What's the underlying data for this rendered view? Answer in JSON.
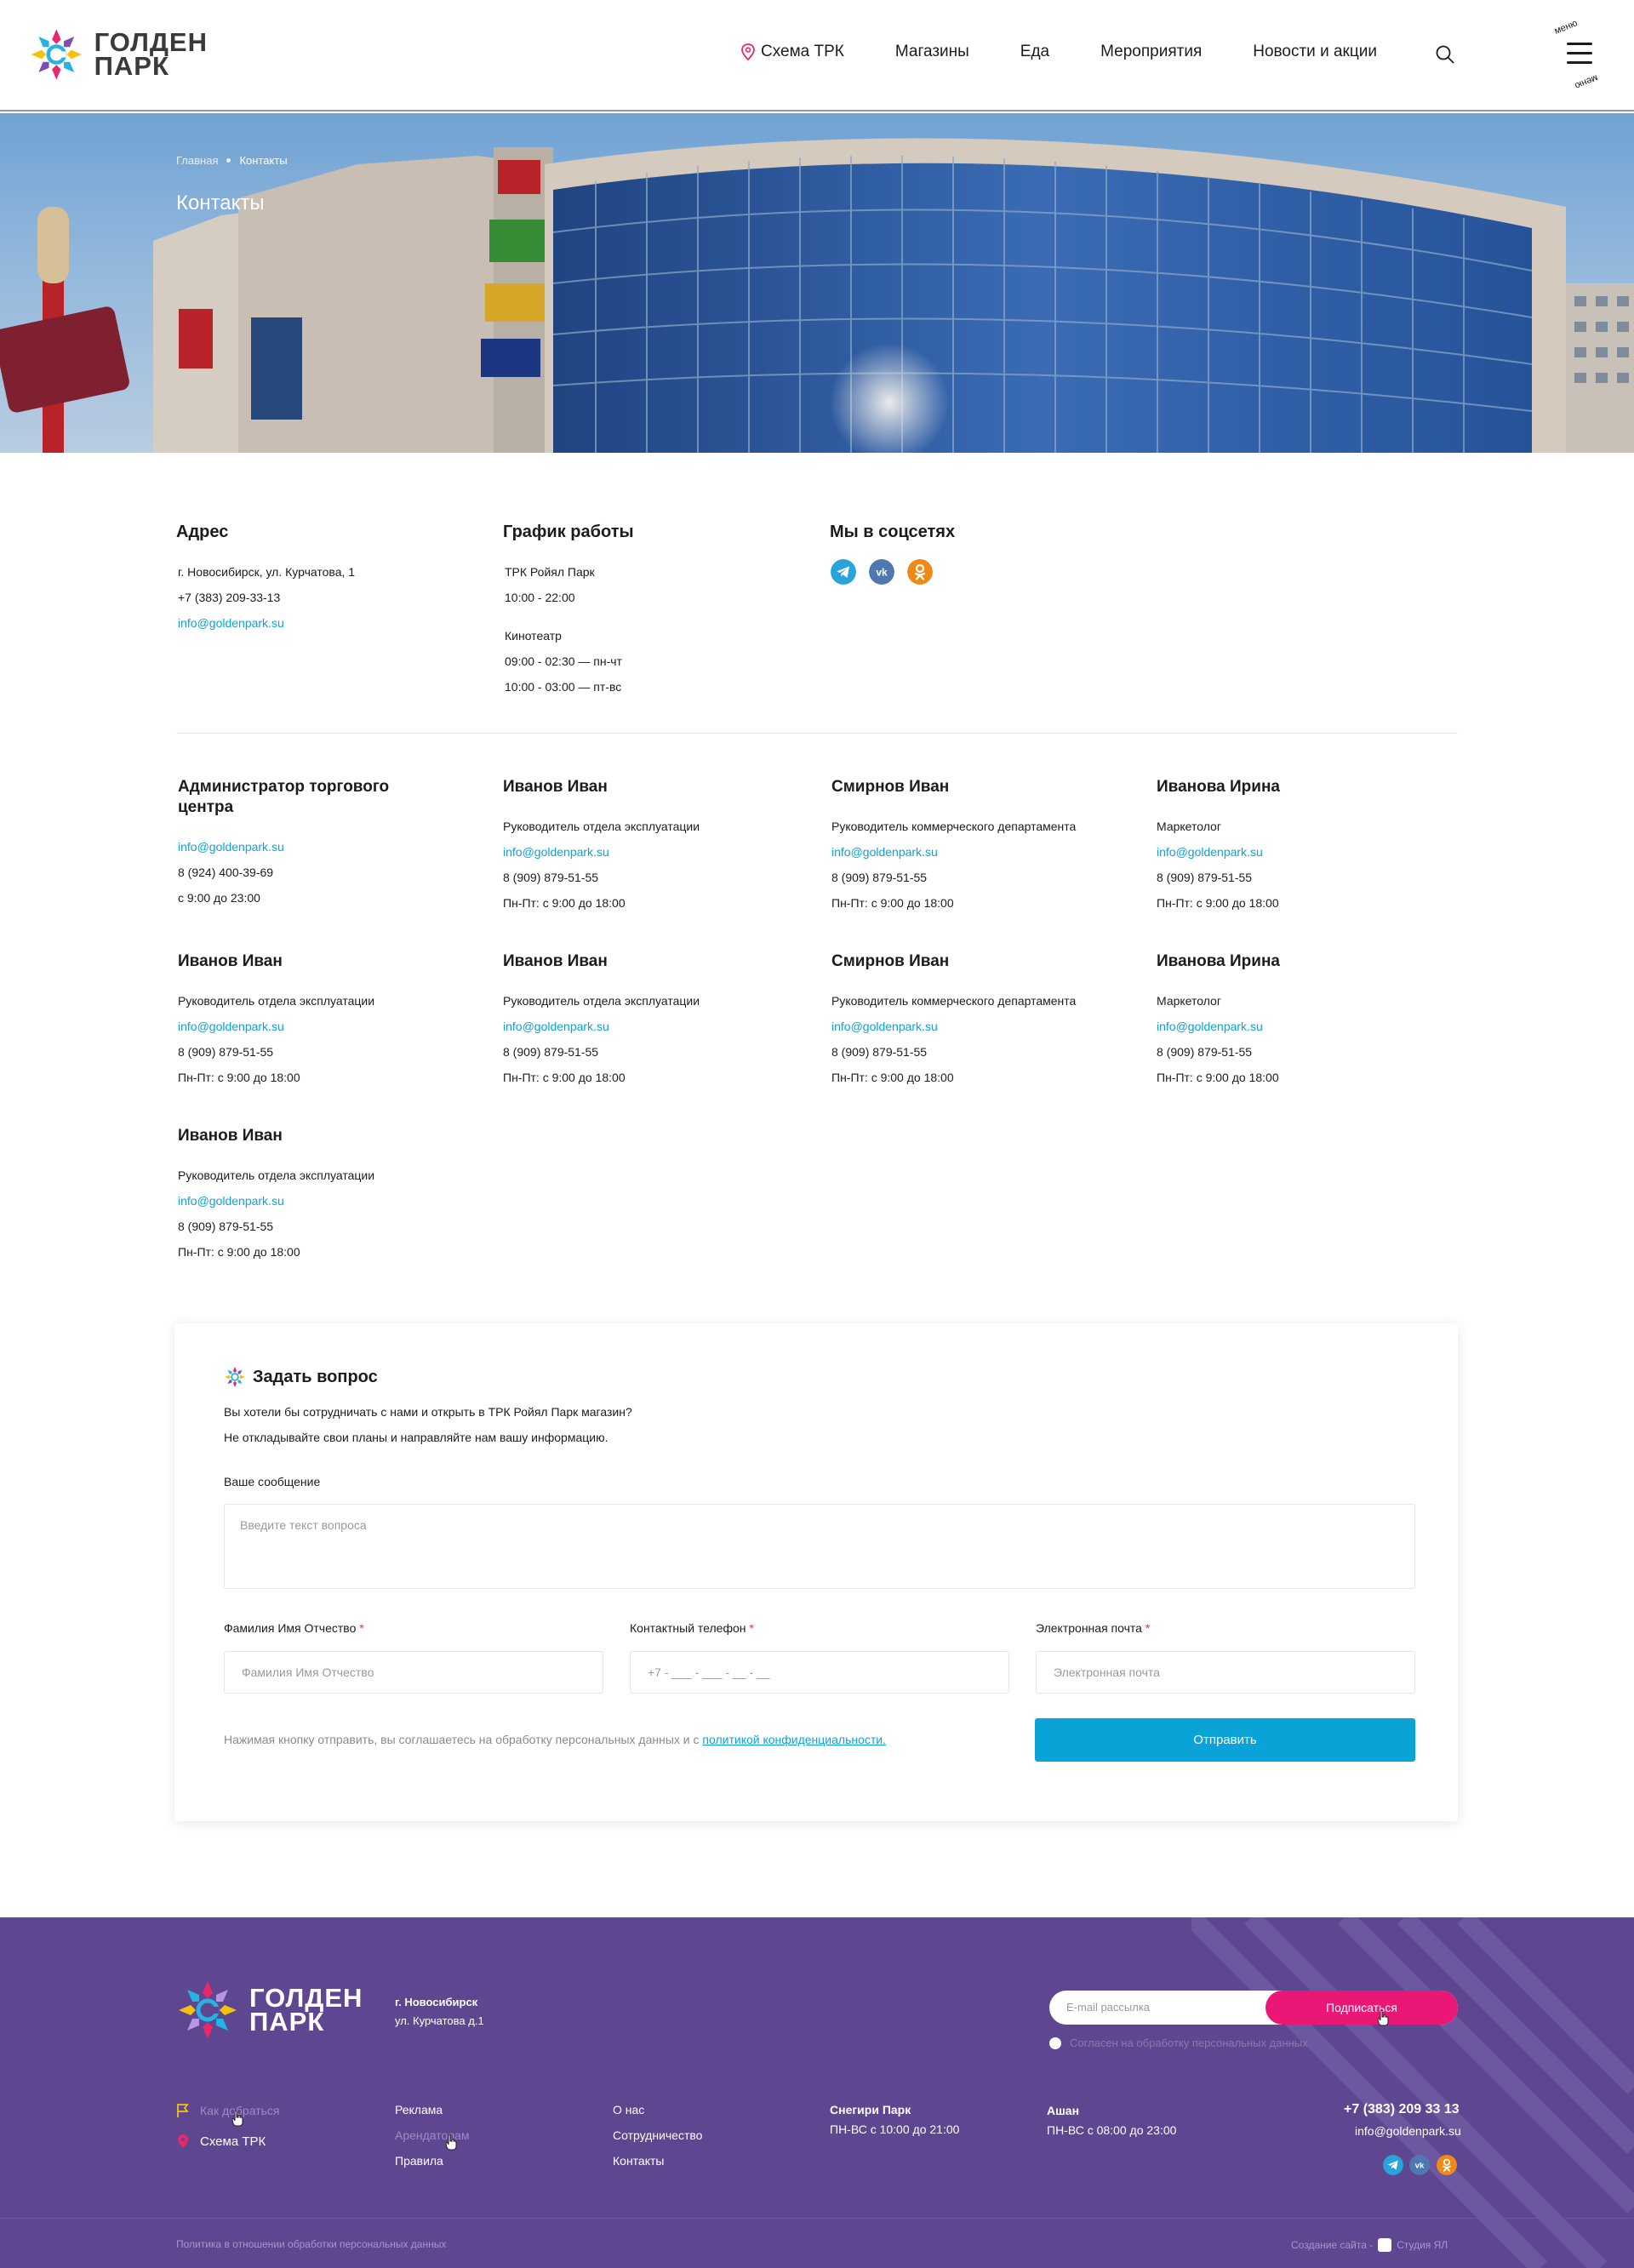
{
  "header": {
    "logo_line1": "ГОЛДЕН",
    "logo_line2": "ПАРК",
    "nav": {
      "scheme": "Схема ТРК",
      "shops": "Магазины",
      "food": "Еда",
      "events": "Мероприятия",
      "news": "Новости и акции"
    },
    "menu_label": "меню"
  },
  "hero": {
    "breadcrumb_home": "Главная",
    "breadcrumb_current": "Контакты",
    "title": "Контакты"
  },
  "info": {
    "address": {
      "title": "Адрес",
      "line": "г. Новосибирск, ул. Курчатова, 1",
      "phone": "+7 (383) 209-33-13",
      "email": "info@goldenpark.su"
    },
    "schedule": {
      "title": "График работы",
      "mall_name": "ТРК Ройял Парк",
      "mall_hours": "10:00 - 22:00",
      "cinema_name": "Кинотеатр",
      "cinema_hours_1": "09:00 - 02:30 — пн-чт",
      "cinema_hours_2": "10:00 - 03:00 — пт-вс"
    },
    "social": {
      "title": "Мы в соцсетях",
      "icons": [
        "telegram-icon",
        "vk-icon",
        "odnoklassniki-icon"
      ],
      "colors": {
        "telegram": "#2aa3db",
        "vk": "#4f78b3",
        "ok": "#f08a16"
      }
    }
  },
  "staff": [
    {
      "name": "Администратор торгового центра",
      "role": "",
      "email": "info@goldenpark.su",
      "phone": "8 (924) 400-39-69",
      "hours": "с 9:00 до 23:00"
    },
    {
      "name": "Иванов Иван",
      "role": "Руководитель отдела эксплуатации",
      "email": "info@goldenpark.su",
      "phone": "8 (909) 879-51-55",
      "hours": "Пн-Пт: с 9:00 до 18:00"
    },
    {
      "name": "Смирнов Иван",
      "role": "Руководитель коммерческого департамента",
      "email": "info@goldenpark.su",
      "phone": "8 (909) 879-51-55",
      "hours": "Пн-Пт: с 9:00 до 18:00"
    },
    {
      "name": "Иванова Ирина",
      "role": "Маркетолог",
      "email": "info@goldenpark.su",
      "phone": "8 (909) 879-51-55",
      "hours": "Пн-Пт: с 9:00 до 18:00"
    },
    {
      "name": "Иванов Иван",
      "role": "Руководитель отдела эксплуатации",
      "email": "info@goldenpark.su",
      "phone": "8 (909) 879-51-55",
      "hours": "Пн-Пт: с 9:00 до 18:00"
    },
    {
      "name": "Иванов Иван",
      "role": "Руководитель отдела эксплуатации",
      "email": "info@goldenpark.su",
      "phone": "8 (909) 879-51-55",
      "hours": "Пн-Пт: с 9:00 до 18:00"
    },
    {
      "name": "Смирнов Иван",
      "role": "Руководитель коммерческого департамента",
      "email": "info@goldenpark.su",
      "phone": "8 (909) 879-51-55",
      "hours": "Пн-Пт: с 9:00 до 18:00"
    },
    {
      "name": "Иванова Ирина",
      "role": "Маркетолог",
      "email": "info@goldenpark.su",
      "phone": "8 (909) 879-51-55",
      "hours": "Пн-Пт: с 9:00 до 18:00"
    },
    {
      "name": "Иванов Иван",
      "role": "Руководитель отдела эксплуатации",
      "email": "info@goldenpark.su",
      "phone": "8 (909) 879-51-55",
      "hours": "Пн-Пт: с 9:00 до 18:00"
    }
  ],
  "form": {
    "title": "Задать вопрос",
    "intro_1": "Вы хотели бы сотрудничать с нами и открыть в ТРК Ройял Парк магазин?",
    "intro_2": "Не откладывайте свои планы и направляйте нам вашу информацию.",
    "message_label": "Ваше сообщение",
    "message_placeholder": "Введите текст вопроса",
    "name_label": "Фамилия Имя Отчество",
    "name_placeholder": "Фамилия Имя Отчество",
    "phone_label": "Контактный телефон",
    "phone_placeholder": "+7 - ___ - ___ - __ - __",
    "email_label": "Электронная почта",
    "email_placeholder": "Электронная почта",
    "required_mark": "*",
    "consent_text": "Нажимая кнопку отправить, вы соглашаетесь на обработку персональных данных и с",
    "consent_link": "политикой конфиденциальности.",
    "submit_label": "Отправить"
  },
  "footer": {
    "logo_line1": "ГОЛДЕН",
    "logo_line2": "ПАРК",
    "city": "г. Новосибирск",
    "street": "ул. Курчатова д.1",
    "subscribe_placeholder": "E-mail рассылка",
    "subscribe_button": "Подписаться",
    "subscribe_consent": "Согласен на обработку персональных данных",
    "how_to_get": "Как добраться",
    "scheme": "Схема ТРК",
    "col2": [
      "Реклама",
      "Арендаторам",
      "Правила"
    ],
    "col3": [
      "О нас",
      "Сотрудничество",
      "Контакты"
    ],
    "store1_name": "Снегири Парк",
    "store1_hours": "ПН-ВС с 10:00 до 21:00",
    "store2_name": "Ашан",
    "store2_hours": "ПН-ВС с 08:00 до 23:00",
    "phone": "+7 (383) 209 33 13",
    "email": "info@goldenpark.su",
    "policy": "Политика в отношении обработки персональных данных",
    "credit_prefix": "Создание сайта -",
    "credit_studio": "Студия ЯЛ",
    "colors": {
      "bg": "#5e4690",
      "accent": "#ea1776"
    }
  }
}
